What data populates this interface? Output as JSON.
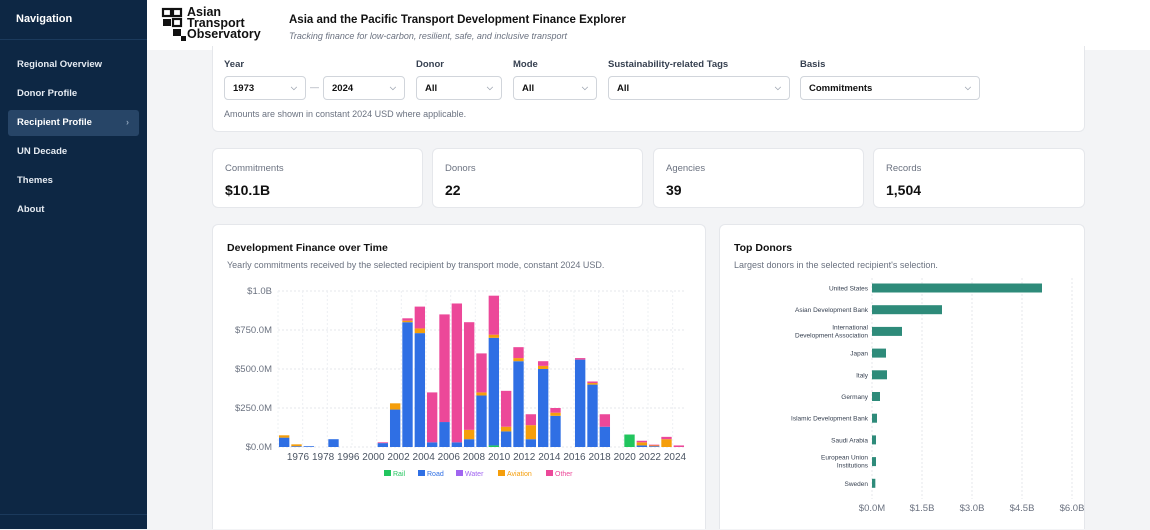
{
  "sidebar": {
    "title": "Navigation",
    "items": [
      {
        "label": "Regional Overview",
        "active": false
      },
      {
        "label": "Donor Profile",
        "active": false
      },
      {
        "label": "Recipient Profile",
        "active": true
      },
      {
        "label": "UN Decade",
        "active": false
      },
      {
        "label": "Themes",
        "active": false
      },
      {
        "label": "About",
        "active": false
      }
    ],
    "active_chevron": "›"
  },
  "header": {
    "logo_lines": [
      "Asian",
      "Transport",
      "Observatory"
    ],
    "title": "Asia and the Pacific Transport Development Finance Explorer",
    "subtitle": "Tracking finance for low-carbon, resilient, safe, and inclusive transport"
  },
  "filters": {
    "year_label": "Year",
    "year_from": "1973",
    "year_to": "2024",
    "donor_label": "Donor",
    "donor_value": "All",
    "mode_label": "Mode",
    "mode_value": "All",
    "tags_label": "Sustainability-related Tags",
    "tags_value": "All",
    "basis_label": "Basis",
    "basis_value": "Commitments",
    "note": "Amounts are shown in constant 2024 USD where applicable."
  },
  "stats": [
    {
      "label": "Commitments",
      "value": "$10.1B"
    },
    {
      "label": "Donors",
      "value": "22"
    },
    {
      "label": "Agencies",
      "value": "39"
    },
    {
      "label": "Records",
      "value": "1,504"
    }
  ],
  "time_panel": {
    "title": "Development Finance over Time",
    "subtitle": "Yearly commitments received by the selected recipient by transport mode, constant 2024 USD."
  },
  "donor_panel": {
    "title": "Top Donors",
    "subtitle": "Largest donors in the selected recipient's selection."
  },
  "colors": {
    "Rail": "#22c55e",
    "Road": "#2f6fe4",
    "Water": "#a065f0",
    "Aviation": "#f59e0b",
    "Other": "#ec4899",
    "donor_bar": "#2e8b7a",
    "sidebar": "#0d2744"
  },
  "chart_data": [
    {
      "type": "bar",
      "stacked": true,
      "x_tick_labels": [
        "1976",
        "1978",
        "1996",
        "2000",
        "2002",
        "2004",
        "2006",
        "2008",
        "2010",
        "2012",
        "2014",
        "2016",
        "2018",
        "2020",
        "2022",
        "2024"
      ],
      "y_tick_labels": [
        "$0.0M",
        "$250.0M",
        "$500.0M",
        "$750.0M",
        "$1.0B"
      ],
      "ylim": [
        0,
        1000
      ],
      "legend": [
        "Rail",
        "Road",
        "Water",
        "Aviation",
        "Other"
      ],
      "legend_position": "bottom",
      "grid": true,
      "bars": [
        {
          "x": 1973,
          "Rail": 0,
          "Road": 60,
          "Water": 0,
          "Aviation": 15,
          "Other": 0
        },
        {
          "x": 1974,
          "Rail": 0,
          "Road": 5,
          "Water": 0,
          "Aviation": 12,
          "Other": 0
        },
        {
          "x": 1975,
          "Rail": 0,
          "Road": 5,
          "Water": 0,
          "Aviation": 0,
          "Other": 0
        },
        {
          "x": 1977,
          "Rail": 0,
          "Road": 50,
          "Water": 0,
          "Aviation": 0,
          "Other": 0
        },
        {
          "x": 1981,
          "Rail": 0,
          "Road": 25,
          "Water": 0,
          "Aviation": 0,
          "Other": 5
        },
        {
          "x": 1982,
          "Rail": 0,
          "Road": 240,
          "Water": 0,
          "Aviation": 40,
          "Other": 0
        },
        {
          "x": 1983,
          "Rail": 0,
          "Road": 800,
          "Water": 0,
          "Aviation": 10,
          "Other": 15
        },
        {
          "x": 1984,
          "Rail": 0,
          "Road": 730,
          "Water": 0,
          "Aviation": 30,
          "Other": 140
        },
        {
          "x": 1985,
          "Rail": 0,
          "Road": 30,
          "Water": 0,
          "Aviation": 0,
          "Other": 320
        },
        {
          "x": 1986,
          "Rail": 0,
          "Road": 160,
          "Water": 0,
          "Aviation": 0,
          "Other": 690
        },
        {
          "x": 1987,
          "Rail": 0,
          "Road": 30,
          "Water": 0,
          "Aviation": 0,
          "Other": 890
        },
        {
          "x": 1988,
          "Rail": 0,
          "Road": 50,
          "Water": 0,
          "Aviation": 60,
          "Other": 690
        },
        {
          "x": 1989,
          "Rail": 0,
          "Road": 330,
          "Water": 0,
          "Aviation": 20,
          "Other": 250
        },
        {
          "x": 1990,
          "Rail": 10,
          "Road": 690,
          "Water": 0,
          "Aviation": 20,
          "Other": 250
        },
        {
          "x": 1991,
          "Rail": 0,
          "Road": 100,
          "Water": 0,
          "Aviation": 30,
          "Other": 230
        },
        {
          "x": 1992,
          "Rail": 0,
          "Road": 550,
          "Water": 0,
          "Aviation": 20,
          "Other": 70
        },
        {
          "x": 1993,
          "Rail": 0,
          "Road": 50,
          "Water": 0,
          "Aviation": 90,
          "Other": 70
        },
        {
          "x": 1994,
          "Rail": 0,
          "Road": 500,
          "Water": 0,
          "Aviation": 20,
          "Other": 30
        },
        {
          "x": 1995,
          "Rail": 0,
          "Road": 200,
          "Water": 0,
          "Aviation": 20,
          "Other": 30
        },
        {
          "x": 1997,
          "Rail": 0,
          "Road": 560,
          "Water": 0,
          "Aviation": 0,
          "Other": 10
        },
        {
          "x": 1998,
          "Rail": 0,
          "Road": 400,
          "Water": 0,
          "Aviation": 10,
          "Other": 10
        },
        {
          "x": 1999,
          "Rail": 0,
          "Road": 130,
          "Water": 0,
          "Aviation": 0,
          "Other": 80
        },
        {
          "x": 2001,
          "Rail": 80,
          "Road": 0,
          "Water": 0,
          "Aviation": 0,
          "Other": 0
        },
        {
          "x": 2002,
          "Rail": 0,
          "Road": 10,
          "Water": 0,
          "Aviation": 20,
          "Other": 10
        },
        {
          "x": 2003,
          "Rail": 0,
          "Road": 5,
          "Water": 0,
          "Aviation": 5,
          "Other": 5
        },
        {
          "x": 2004,
          "Rail": 0,
          "Road": 0,
          "Water": 0,
          "Aviation": 50,
          "Other": 15
        },
        {
          "x": 2005,
          "Rail": 0,
          "Road": 0,
          "Water": 0,
          "Aviation": 0,
          "Other": 10
        }
      ]
    },
    {
      "type": "bar",
      "orientation": "horizontal",
      "categories": [
        "United States",
        "Asian Development Bank",
        "International Development Association",
        "Japan",
        "Italy",
        "Germany",
        "Islamic Development Bank",
        "Saudi Arabia",
        "European Union Institutions",
        "Sweden"
      ],
      "values": [
        5.1,
        2.1,
        0.9,
        0.42,
        0.45,
        0.24,
        0.15,
        0.12,
        0.12,
        0.1
      ],
      "unit": "billion USD",
      "x_tick_labels": [
        "$0.0M",
        "$1.5B",
        "$3.0B",
        "$4.5B",
        "$6.0B"
      ],
      "xlim": [
        0,
        6.0
      ]
    }
  ]
}
